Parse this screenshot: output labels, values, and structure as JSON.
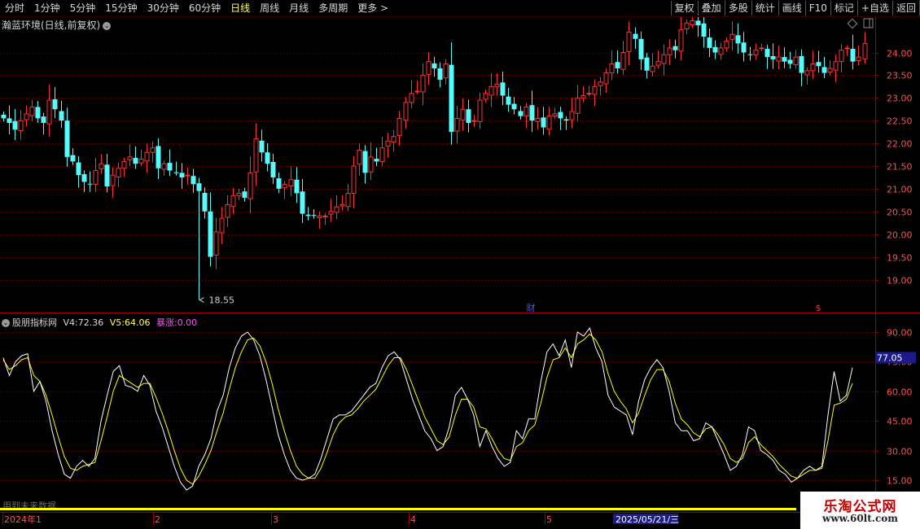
{
  "toolbar": {
    "periods": [
      "分时",
      "1分钟",
      "5分钟",
      "15分钟",
      "30分钟",
      "60分钟",
      "日线",
      "周线",
      "月线",
      "多周期",
      "更多 >"
    ],
    "active_period": "日线",
    "actions": [
      "复权",
      "叠加",
      "多股",
      "统计",
      "画线",
      "F10",
      "标记",
      "+自选",
      "返回"
    ]
  },
  "main_chart": {
    "title": "瀚蓝环境(日线,前复权)",
    "y_labels": [
      "24.00",
      "23.50",
      "23.00",
      "22.50",
      "22.00",
      "21.50",
      "21.00",
      "20.50",
      "20.00",
      "19.50",
      "19.00"
    ],
    "y_range": [
      18.5,
      24.9
    ],
    "high_marker": "24.89",
    "low_marker": "18.55",
    "event_marks": [
      "财",
      "$"
    ]
  },
  "indicator": {
    "name": "股朋指标网",
    "v4_label": "V4:",
    "v4_value": "72.36",
    "v5_label": "V5:",
    "v5_value": "64.06",
    "bz_label": "暴涨:",
    "bz_value": "0.00",
    "y_labels": [
      "90.00",
      "75.00",
      "60.00",
      "45.00",
      "30.00",
      "15.00"
    ],
    "y_range": [
      12,
      95
    ],
    "current_value": "77.05",
    "note": "用到未来数据"
  },
  "time_axis": {
    "labels": [
      "2024年1",
      "2",
      "3",
      "4",
      "5"
    ],
    "cursor_date": "2025/05/21/三"
  },
  "colors": {
    "up": "#ff3232",
    "down": "#54fcfc",
    "grid": "#7a0000",
    "v4": "#ffffff",
    "v5": "#ffff00",
    "axis_text": "#ff5050"
  },
  "watermark": {
    "name": "乐淘公式网",
    "url": "www.60lt.com"
  },
  "chart_data": [
    {
      "type": "candlestick",
      "title": "瀚蓝环境(日线,前复权)",
      "ylim": [
        18.5,
        24.9
      ],
      "close": [
        22.55,
        22.45,
        22.3,
        22.5,
        22.65,
        22.8,
        22.55,
        22.45,
        22.95,
        22.75,
        22.5,
        21.7,
        21.6,
        21.3,
        21.15,
        21.1,
        21.4,
        21.55,
        21.05,
        21.3,
        21.45,
        21.6,
        21.7,
        21.55,
        21.65,
        21.8,
        21.9,
        21.45,
        21.55,
        21.4,
        21.35,
        21.25,
        21.3,
        21.1,
        20.95,
        20.5,
        19.5,
        20.05,
        20.35,
        20.65,
        20.85,
        20.9,
        20.8,
        21.35,
        22.1,
        21.8,
        21.55,
        21.25,
        21.0,
        21.1,
        21.2,
        20.9,
        20.45,
        20.4,
        20.4,
        20.4,
        20.4,
        20.5,
        20.6,
        20.65,
        20.9,
        21.5,
        21.85,
        21.35,
        21.7,
        21.6,
        21.9,
        22.05,
        22.15,
        22.55,
        22.9,
        23.1,
        23.15,
        23.5,
        23.8,
        23.65,
        23.4,
        23.75,
        22.25,
        22.55,
        22.75,
        22.45,
        22.5,
        22.95,
        23.1,
        23.25,
        23.3,
        23.05,
        22.85,
        22.75,
        22.6,
        22.8,
        22.5,
        22.55,
        22.35,
        22.6,
        22.65,
        22.55,
        22.5,
        22.7,
        23.0,
        23.05,
        23.1,
        23.25,
        23.35,
        23.55,
        23.75,
        23.65,
        24.0,
        24.45,
        24.3,
        23.85,
        23.6,
        23.7,
        23.8,
        23.95,
        24.1,
        24.05,
        24.5,
        24.65,
        24.7,
        24.6,
        24.35,
        24.1,
        24.0,
        24.1,
        24.25,
        24.4,
        24.2,
        24.0,
        23.95,
        24.05,
        24.1,
        23.9,
        23.85,
        23.9,
        23.8,
        23.75,
        23.9,
        23.55,
        23.6,
        23.75,
        23.7,
        23.55,
        23.65,
        23.8,
        24.05,
        24.1,
        23.8,
        23.9,
        24.2
      ]
    },
    {
      "type": "line",
      "ylim": [
        12,
        95
      ],
      "series": [
        {
          "name": "V4",
          "values": [
            77,
            68,
            75,
            78,
            79,
            60,
            65,
            55,
            40,
            28,
            18,
            16,
            22,
            25,
            22,
            26,
            45,
            58,
            70,
            73,
            63,
            62,
            60,
            68,
            63,
            50,
            42,
            32,
            22,
            14,
            10,
            12,
            22,
            28,
            36,
            50,
            58,
            72,
            82,
            88,
            90,
            86,
            78,
            66,
            52,
            38,
            28,
            20,
            16,
            15,
            16,
            18,
            26,
            36,
            46,
            48,
            48,
            50,
            54,
            58,
            62,
            64,
            72,
            78,
            80,
            76,
            66,
            56,
            48,
            40,
            36,
            30,
            32,
            42,
            58,
            62,
            56,
            48,
            32,
            40,
            32,
            26,
            22,
            24,
            40,
            36,
            46,
            46,
            65,
            80,
            84,
            78,
            86,
            72,
            90,
            88,
            92,
            82,
            75,
            58,
            52,
            50,
            48,
            38,
            55,
            66,
            72,
            76,
            72,
            60,
            44,
            40,
            40,
            35,
            36,
            44,
            42,
            35,
            28,
            20,
            22,
            28,
            42,
            40,
            30,
            28,
            25,
            20,
            18,
            14,
            16,
            20,
            22,
            20,
            22,
            48,
            70,
            55,
            58,
            72
          ]
        },
        {
          "name": "V5",
          "values": [
            76,
            71,
            73,
            76,
            77,
            68,
            65,
            58,
            48,
            37,
            27,
            21,
            20,
            22,
            23,
            24,
            35,
            47,
            60,
            68,
            66,
            64,
            62,
            64,
            64,
            57,
            49,
            40,
            30,
            21,
            15,
            13,
            17,
            23,
            30,
            40,
            49,
            61,
            72,
            80,
            86,
            87,
            83,
            75,
            64,
            51,
            40,
            30,
            22,
            18,
            16,
            16,
            21,
            29,
            38,
            44,
            47,
            48,
            51,
            55,
            58,
            61,
            67,
            73,
            77,
            77,
            71,
            63,
            55,
            47,
            41,
            35,
            33,
            37,
            48,
            56,
            56,
            52,
            42,
            41,
            36,
            30,
            26,
            25,
            32,
            34,
            40,
            43,
            54,
            67,
            76,
            77,
            82,
            77,
            84,
            86,
            89,
            86,
            80,
            69,
            60,
            55,
            51,
            44,
            49,
            58,
            66,
            71,
            71,
            65,
            54,
            46,
            43,
            39,
            37,
            41,
            42,
            38,
            33,
            26,
            24,
            26,
            34,
            37,
            33,
            30,
            27,
            23,
            20,
            17,
            16,
            18,
            20,
            20,
            21,
            35,
            53,
            54,
            56,
            64
          ]
        }
      ]
    }
  ]
}
